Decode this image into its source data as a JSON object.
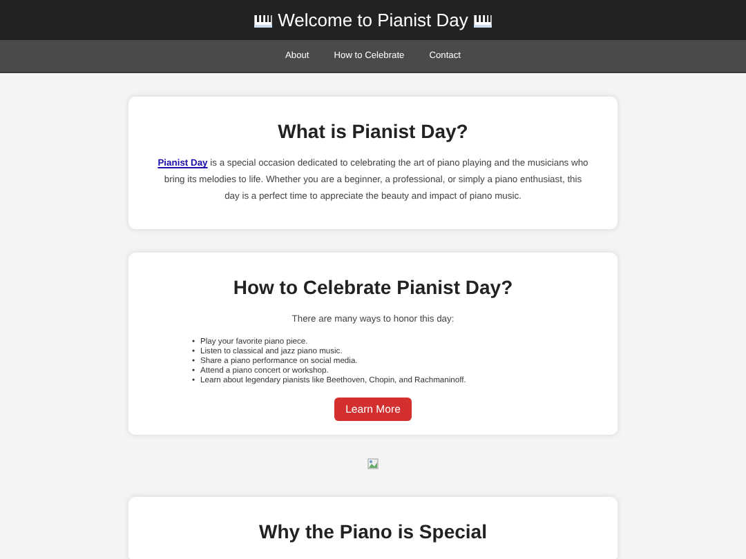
{
  "header": {
    "title": "Welcome to Pianist Day"
  },
  "nav": {
    "items": [
      {
        "label": "About"
      },
      {
        "label": "How to Celebrate"
      },
      {
        "label": "Contact"
      }
    ]
  },
  "sections": [
    {
      "kind": "text",
      "title": "What is Pianist Day?",
      "link_text": "Pianist Day",
      "text": "is a special occasion dedicated to celebrating the art of piano playing and the musicians who bring its melodies to life. Whether you are a beginner, a professional, or simply a piano enthusiast, this day is a perfect time to appreciate the beauty and impact of piano music."
    },
    {
      "kind": "list",
      "title": "How to Celebrate Pianist Day?",
      "intro": "There are many ways to honor this day:",
      "bullet": "•",
      "items": [
        "Play your favorite piano piece.",
        "Listen to classical and jazz piano music.",
        "Share a piano performance on social media.",
        "Attend a piano concert or workshop.",
        "Learn about legendary pianists like Beethoven, Chopin, and Rachmaninoff."
      ],
      "button": "Learn More"
    },
    {
      "kind": "image"
    },
    {
      "kind": "heading",
      "title": "Why the Piano is Special"
    }
  ]
}
